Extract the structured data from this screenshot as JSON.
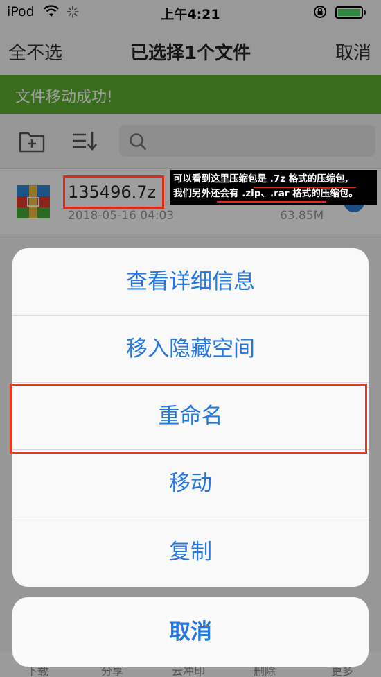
{
  "status_bar": {
    "carrier": "iPod",
    "time": "上午4:21"
  },
  "nav": {
    "select_none": "全不选",
    "title": "已选择1个文件",
    "cancel": "取消"
  },
  "toast": {
    "message": "文件移动成功!"
  },
  "file": {
    "name": "135496.7z",
    "date": "2018-05-16 04:03",
    "size": "63.85M"
  },
  "annotation": {
    "line1": "可以看到这里压缩包是 .7z 格式的压缩包,",
    "line2": "我们另外还会有 .zip、.rar 格式的压缩包。"
  },
  "action_sheet": {
    "items": [
      {
        "label": "查看详细信息"
      },
      {
        "label": "移入隐藏空间"
      },
      {
        "label": "重命名"
      },
      {
        "label": "移动"
      },
      {
        "label": "复制"
      }
    ],
    "cancel": "取消"
  },
  "bottom_tabs": [
    "下载",
    "分享",
    "云冲印",
    "删除",
    "更多"
  ],
  "colors": {
    "accent": "#2478e0",
    "toast": "#5cae2f",
    "highlight": "#e53a1c"
  }
}
